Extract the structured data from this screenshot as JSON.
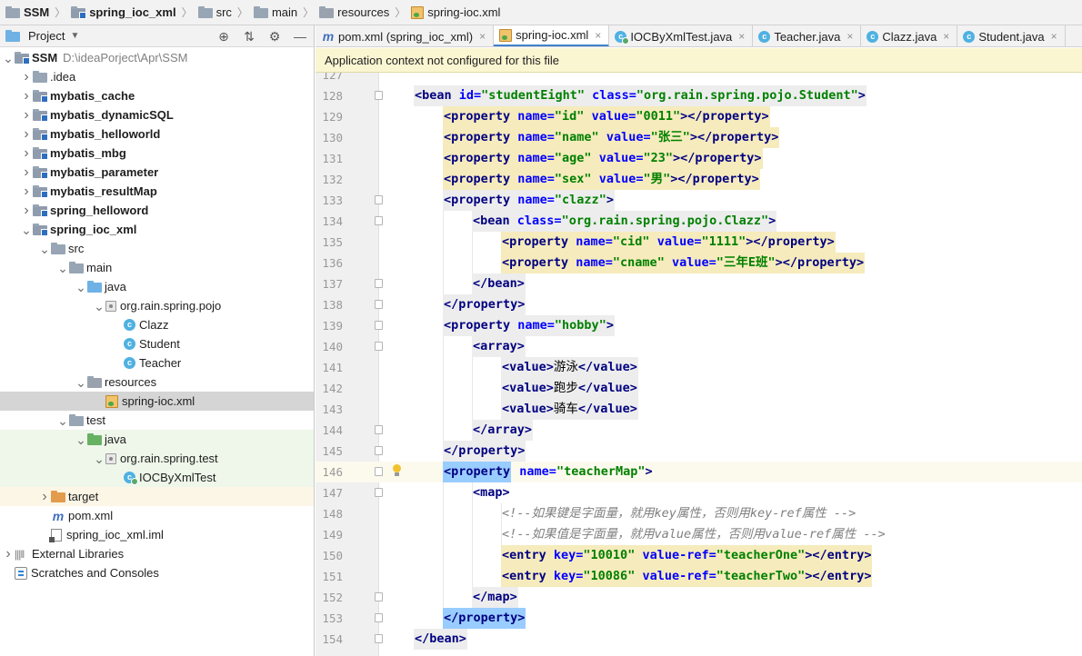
{
  "breadcrumb": [
    {
      "label": "SSM",
      "icon": "project-folder-icon",
      "bold": true
    },
    {
      "label": "spring_ioc_xml",
      "icon": "module-folder-icon",
      "bold": true
    },
    {
      "label": "src",
      "icon": "folder-icon",
      "bold": false
    },
    {
      "label": "main",
      "icon": "folder-icon",
      "bold": false
    },
    {
      "label": "resources",
      "icon": "resources-folder-icon",
      "bold": false
    },
    {
      "label": "spring-ioc.xml",
      "icon": "xml-file-icon",
      "bold": false
    }
  ],
  "project_panel": {
    "title": "Project",
    "tree": [
      {
        "depth": 0,
        "arrow": "down",
        "icon": "module",
        "label": "SSM",
        "bold": true,
        "suffix": "D:\\ideaPorject\\Apr\\SSM"
      },
      {
        "depth": 1,
        "arrow": "right",
        "icon": "folder",
        "label": ".idea"
      },
      {
        "depth": 1,
        "arrow": "right",
        "icon": "module",
        "label": "mybatis_cache",
        "bold": true
      },
      {
        "depth": 1,
        "arrow": "right",
        "icon": "module",
        "label": "mybatis_dynamicSQL",
        "bold": true
      },
      {
        "depth": 1,
        "arrow": "right",
        "icon": "module",
        "label": "mybatis_helloworld",
        "bold": true
      },
      {
        "depth": 1,
        "arrow": "right",
        "icon": "module",
        "label": "mybatis_mbg",
        "bold": true
      },
      {
        "depth": 1,
        "arrow": "right",
        "icon": "module",
        "label": "mybatis_parameter",
        "bold": true
      },
      {
        "depth": 1,
        "arrow": "right",
        "icon": "module",
        "label": "mybatis_resultMap",
        "bold": true
      },
      {
        "depth": 1,
        "arrow": "right",
        "icon": "module",
        "label": "spring_helloword",
        "bold": true
      },
      {
        "depth": 1,
        "arrow": "down",
        "icon": "module",
        "label": "spring_ioc_xml",
        "bold": true
      },
      {
        "depth": 2,
        "arrow": "down",
        "icon": "folder",
        "label": "src"
      },
      {
        "depth": 3,
        "arrow": "down",
        "icon": "folder",
        "label": "main"
      },
      {
        "depth": 4,
        "arrow": "down",
        "icon": "folder-blue",
        "label": "java"
      },
      {
        "depth": 5,
        "arrow": "down",
        "icon": "package",
        "label": "org.rain.spring.pojo"
      },
      {
        "depth": 6,
        "arrow": "",
        "icon": "class",
        "label": "Clazz"
      },
      {
        "depth": 6,
        "arrow": "",
        "icon": "class",
        "label": "Student"
      },
      {
        "depth": 6,
        "arrow": "",
        "icon": "class",
        "label": "Teacher"
      },
      {
        "depth": 4,
        "arrow": "down",
        "icon": "folder-res",
        "label": "resources"
      },
      {
        "depth": 5,
        "arrow": "",
        "icon": "xml",
        "label": "spring-ioc.xml",
        "selected": true
      },
      {
        "depth": 3,
        "arrow": "down",
        "icon": "folder",
        "label": "test"
      },
      {
        "depth": 4,
        "arrow": "down",
        "icon": "folder-green",
        "label": "java",
        "test": true
      },
      {
        "depth": 5,
        "arrow": "down",
        "icon": "package",
        "label": "org.rain.spring.test",
        "test": true
      },
      {
        "depth": 6,
        "arrow": "",
        "icon": "class-test",
        "label": "IOCByXmlTest",
        "test": true
      },
      {
        "depth": 2,
        "arrow": "right",
        "icon": "folder-orange",
        "label": "target",
        "excluded": true
      },
      {
        "depth": 2,
        "arrow": "",
        "icon": "maven",
        "label": "pom.xml"
      },
      {
        "depth": 2,
        "arrow": "",
        "icon": "iml",
        "label": "spring_ioc_xml.iml"
      },
      {
        "depth": 0,
        "arrow": "right",
        "icon": "library",
        "label": "External Libraries"
      },
      {
        "depth": 0,
        "arrow": "",
        "icon": "scratches",
        "label": "Scratches and Consoles"
      }
    ]
  },
  "tabs": [
    {
      "label": "pom.xml (spring_ioc_xml)",
      "icon": "maven",
      "active": false
    },
    {
      "label": "spring-ioc.xml",
      "icon": "xml",
      "active": true
    },
    {
      "label": "IOCByXmlTest.java",
      "icon": "class-test",
      "active": false
    },
    {
      "label": "Teacher.java",
      "icon": "class",
      "active": false
    },
    {
      "label": "Clazz.java",
      "icon": "class",
      "active": false
    },
    {
      "label": "Student.java",
      "icon": "class",
      "active": false
    }
  ],
  "notification": "Application context not configured for this file",
  "editor": {
    "lines": [
      {
        "n": "127",
        "indent": 1,
        "partial": true,
        "tokens": []
      },
      {
        "n": "128",
        "indent": 1,
        "fold": true,
        "tokens": [
          [
            "hlG",
            "",
            [
              [
                "tag",
                "<bean "
              ],
              [
                "attr",
                "id="
              ],
              [
                "val",
                "\"studentEight\""
              ],
              [
                "txt",
                " "
              ],
              [
                "attr",
                "class="
              ],
              [
                "val",
                "\"org.rain.spring.pojo.Student\""
              ],
              [
                "tag",
                ">"
              ]
            ]
          ]
        ]
      },
      {
        "n": "129",
        "indent": 2,
        "tokens": [
          [
            "hlY",
            "",
            [
              [
                "tag",
                "<property "
              ],
              [
                "attr",
                "name="
              ],
              [
                "val",
                "\"id\""
              ],
              [
                "txt",
                " "
              ],
              [
                "attr",
                "value="
              ],
              [
                "val",
                "\"0011\""
              ],
              [
                "tag",
                "></property>"
              ]
            ]
          ]
        ]
      },
      {
        "n": "130",
        "indent": 2,
        "tokens": [
          [
            "hlY",
            "",
            [
              [
                "tag",
                "<property "
              ],
              [
                "attr",
                "name="
              ],
              [
                "val",
                "\"name\""
              ],
              [
                "txt",
                " "
              ],
              [
                "attr",
                "value="
              ],
              [
                "val",
                "\"张三\""
              ],
              [
                "tag",
                "></property>"
              ]
            ]
          ]
        ]
      },
      {
        "n": "131",
        "indent": 2,
        "tokens": [
          [
            "hlY",
            "",
            [
              [
                "tag",
                "<property "
              ],
              [
                "attr",
                "name="
              ],
              [
                "val",
                "\"age\""
              ],
              [
                "txt",
                " "
              ],
              [
                "attr",
                "value="
              ],
              [
                "val",
                "\"23\""
              ],
              [
                "tag",
                "></property>"
              ]
            ]
          ]
        ]
      },
      {
        "n": "132",
        "indent": 2,
        "tokens": [
          [
            "hlY",
            "",
            [
              [
                "tag",
                "<property "
              ],
              [
                "attr",
                "name="
              ],
              [
                "val",
                "\"sex\""
              ],
              [
                "txt",
                " "
              ],
              [
                "attr",
                "value="
              ],
              [
                "val",
                "\"男\""
              ],
              [
                "tag",
                "></property>"
              ]
            ]
          ]
        ]
      },
      {
        "n": "133",
        "indent": 2,
        "fold": true,
        "tokens": [
          [
            "hlG",
            "",
            [
              [
                "tag",
                "<property "
              ],
              [
                "attr",
                "name="
              ],
              [
                "val",
                "\"clazz\""
              ],
              [
                "tag",
                ">"
              ]
            ]
          ]
        ]
      },
      {
        "n": "134",
        "indent": 3,
        "fold": true,
        "tokens": [
          [
            "hlG",
            "",
            [
              [
                "tag",
                "<bean "
              ],
              [
                "attr",
                "class="
              ],
              [
                "val",
                "\"org.rain.spring.pojo.Clazz\""
              ],
              [
                "tag",
                ">"
              ]
            ]
          ]
        ]
      },
      {
        "n": "135",
        "indent": 4,
        "tokens": [
          [
            "hlY",
            "",
            [
              [
                "tag",
                "<property "
              ],
              [
                "attr",
                "name="
              ],
              [
                "val",
                "\"cid\""
              ],
              [
                "txt",
                " "
              ],
              [
                "attr",
                "value="
              ],
              [
                "val",
                "\"1111\""
              ],
              [
                "tag",
                "></property>"
              ]
            ]
          ]
        ]
      },
      {
        "n": "136",
        "indent": 4,
        "tokens": [
          [
            "hlY",
            "",
            [
              [
                "tag",
                "<property "
              ],
              [
                "attr",
                "name="
              ],
              [
                "val",
                "\"cname\""
              ],
              [
                "txt",
                " "
              ],
              [
                "attr",
                "value="
              ],
              [
                "val",
                "\"三年E班\""
              ],
              [
                "tag",
                "></property>"
              ]
            ]
          ]
        ]
      },
      {
        "n": "137",
        "indent": 3,
        "fold": true,
        "tokens": [
          [
            "hlG",
            "",
            [
              [
                "tag",
                "</bean>"
              ]
            ]
          ]
        ]
      },
      {
        "n": "138",
        "indent": 2,
        "fold": true,
        "tokens": [
          [
            "hlG",
            "",
            [
              [
                "tag",
                "</property>"
              ]
            ]
          ]
        ]
      },
      {
        "n": "139",
        "indent": 2,
        "fold": true,
        "tokens": [
          [
            "hlG",
            "",
            [
              [
                "tag",
                "<property "
              ],
              [
                "attr",
                "name="
              ],
              [
                "val",
                "\"hobby\""
              ],
              [
                "tag",
                ">"
              ]
            ]
          ]
        ]
      },
      {
        "n": "140",
        "indent": 3,
        "fold": true,
        "tokens": [
          [
            "hlG",
            "",
            [
              [
                "tag",
                "<array>"
              ]
            ]
          ]
        ]
      },
      {
        "n": "141",
        "indent": 4,
        "tokens": [
          [
            "hlG",
            "",
            [
              [
                "tag",
                "<value>"
              ],
              [
                "txt",
                "游泳"
              ],
              [
                "tag",
                "</value>"
              ]
            ]
          ]
        ]
      },
      {
        "n": "142",
        "indent": 4,
        "tokens": [
          [
            "hlG",
            "",
            [
              [
                "tag",
                "<value>"
              ],
              [
                "txt",
                "跑步"
              ],
              [
                "tag",
                "</value>"
              ]
            ]
          ]
        ]
      },
      {
        "n": "143",
        "indent": 4,
        "tokens": [
          [
            "hlG",
            "",
            [
              [
                "tag",
                "<value>"
              ],
              [
                "txt",
                "骑车"
              ],
              [
                "tag",
                "</value>"
              ]
            ]
          ]
        ]
      },
      {
        "n": "144",
        "indent": 3,
        "fold": true,
        "tokens": [
          [
            "hlG",
            "",
            [
              [
                "tag",
                "</array>"
              ]
            ]
          ]
        ]
      },
      {
        "n": "145",
        "indent": 2,
        "fold": true,
        "tokens": [
          [
            "hlG",
            "",
            [
              [
                "tag",
                "</property>"
              ]
            ]
          ]
        ]
      },
      {
        "n": "146",
        "indent": 2,
        "fold": true,
        "bulb": true,
        "current": true,
        "tokens": [
          [
            "hlB",
            "",
            [
              [
                "tag",
                "<property"
              ]
            ]
          ],
          [
            "",
            "",
            [
              [
                "txt",
                " "
              ],
              [
                "attr",
                "name="
              ],
              [
                "val",
                "\"teacherMap\""
              ],
              [
                "tag",
                ">"
              ]
            ]
          ]
        ]
      },
      {
        "n": "147",
        "indent": 3,
        "fold": true,
        "tokens": [
          [
            "",
            "",
            [
              [
                "tag",
                "<map>"
              ]
            ]
          ]
        ]
      },
      {
        "n": "148",
        "indent": 4,
        "tokens": [
          [
            "",
            "",
            [
              [
                "cmt",
                "<!--如果键是字面量，就用key属性，否则用key-ref属性 -->"
              ]
            ]
          ]
        ]
      },
      {
        "n": "149",
        "indent": 4,
        "tokens": [
          [
            "",
            "",
            [
              [
                "cmt",
                "<!--如果值是字面量，就用value属性，否则用value-ref属性 -->"
              ]
            ]
          ]
        ]
      },
      {
        "n": "150",
        "indent": 4,
        "tokens": [
          [
            "hlY",
            "",
            [
              [
                "tag",
                "<entry "
              ],
              [
                "attr",
                "key="
              ],
              [
                "val",
                "\"10010\""
              ],
              [
                "txt",
                " "
              ],
              [
                "attr",
                "value-ref="
              ],
              [
                "val",
                "\"teacherOne\""
              ],
              [
                "tag",
                "></entry>"
              ]
            ]
          ]
        ]
      },
      {
        "n": "151",
        "indent": 4,
        "tokens": [
          [
            "hlY",
            "",
            [
              [
                "tag",
                "<entry "
              ],
              [
                "attr",
                "key="
              ],
              [
                "val",
                "\"10086\""
              ],
              [
                "txt",
                " "
              ],
              [
                "attr",
                "value-ref="
              ],
              [
                "val",
                "\"teacherTwo\""
              ],
              [
                "tag",
                "></entry>"
              ]
            ]
          ]
        ]
      },
      {
        "n": "152",
        "indent": 3,
        "fold": true,
        "tokens": [
          [
            "hlG",
            "",
            [
              [
                "tag",
                "</map>"
              ]
            ]
          ]
        ]
      },
      {
        "n": "153",
        "indent": 2,
        "fold": true,
        "tokens": [
          [
            "hlB",
            "",
            [
              [
                "tag",
                "</property>"
              ]
            ]
          ]
        ]
      },
      {
        "n": "154",
        "indent": 1,
        "fold": true,
        "tokens": [
          [
            "hlG",
            "",
            [
              [
                "tag",
                "</bean>"
              ]
            ]
          ]
        ]
      }
    ]
  },
  "colors": {
    "tag": "#000080",
    "attribute": "#0000ff",
    "value": "#008000",
    "comment": "#808080",
    "notice_bg": "#fbf6d2",
    "selection_bg": "#d5d5d5",
    "active_tab_underline": "#4083c9"
  }
}
